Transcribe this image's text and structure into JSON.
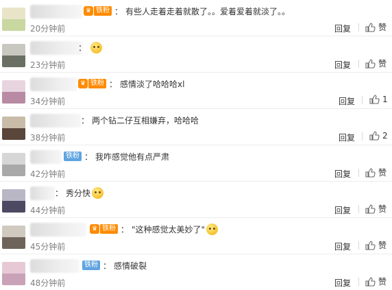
{
  "actions": {
    "reply_label": "回复"
  },
  "comments": [
    {
      "badge": "铁粉",
      "badge_color": "orange",
      "text": "有些人走着走着就散了。。爱着爱着就淡了。。",
      "time": "20分钟前",
      "like": "赞",
      "avatar_top": "#e9e4c7",
      "avatar_bottom": "#c9d7a1"
    },
    {
      "badge": "",
      "badge_color": "",
      "text": "",
      "emoji": "doge-emoji",
      "time": "23分钟前",
      "like": "赞",
      "avatar_top": "#c8c8c0",
      "avatar_bottom": "#6a6f63"
    },
    {
      "badge": "铁粉",
      "badge_color": "orange",
      "text": "感情淡了哈哈哈xl",
      "time": "34分钟前",
      "like": "1",
      "avatar_top": "#e7d4df",
      "avatar_bottom": "#b88aa3"
    },
    {
      "badge": "",
      "badge_color": "",
      "text": "两个钻二仔互相嫌弃，哈哈哈",
      "time": "38分钟前",
      "like": "2",
      "avatar_top": "#c9bca8",
      "avatar_bottom": "#5a463a"
    },
    {
      "badge": "铁粉",
      "badge_color": "blue",
      "text": "我咋感觉他有点严肃",
      "time": "42分钟前",
      "like": "赞",
      "avatar_top": "#d6d6d6",
      "avatar_bottom": "#a9a9a9"
    },
    {
      "badge": "",
      "badge_color": "",
      "text": "秀分快",
      "emoji": "thinking-emoji",
      "time": "44分钟前",
      "like": "赞",
      "avatar_top": "#b9b6c6",
      "avatar_bottom": "#4e4962"
    },
    {
      "badge": "铁粉",
      "badge_color": "orange",
      "text": "\"这种感觉太美妙了\"",
      "emoji": "smile-emoji",
      "time": "45分钟前",
      "like": "赞",
      "avatar_top": "#cfc9bf",
      "avatar_bottom": "#6f6459"
    },
    {
      "badge": "铁粉",
      "badge_color": "blue",
      "text": "感情破裂",
      "time": "48分钟前",
      "like": "赞",
      "avatar_top": "#e7c9d6",
      "avatar_bottom": "#c9a2b8"
    }
  ]
}
